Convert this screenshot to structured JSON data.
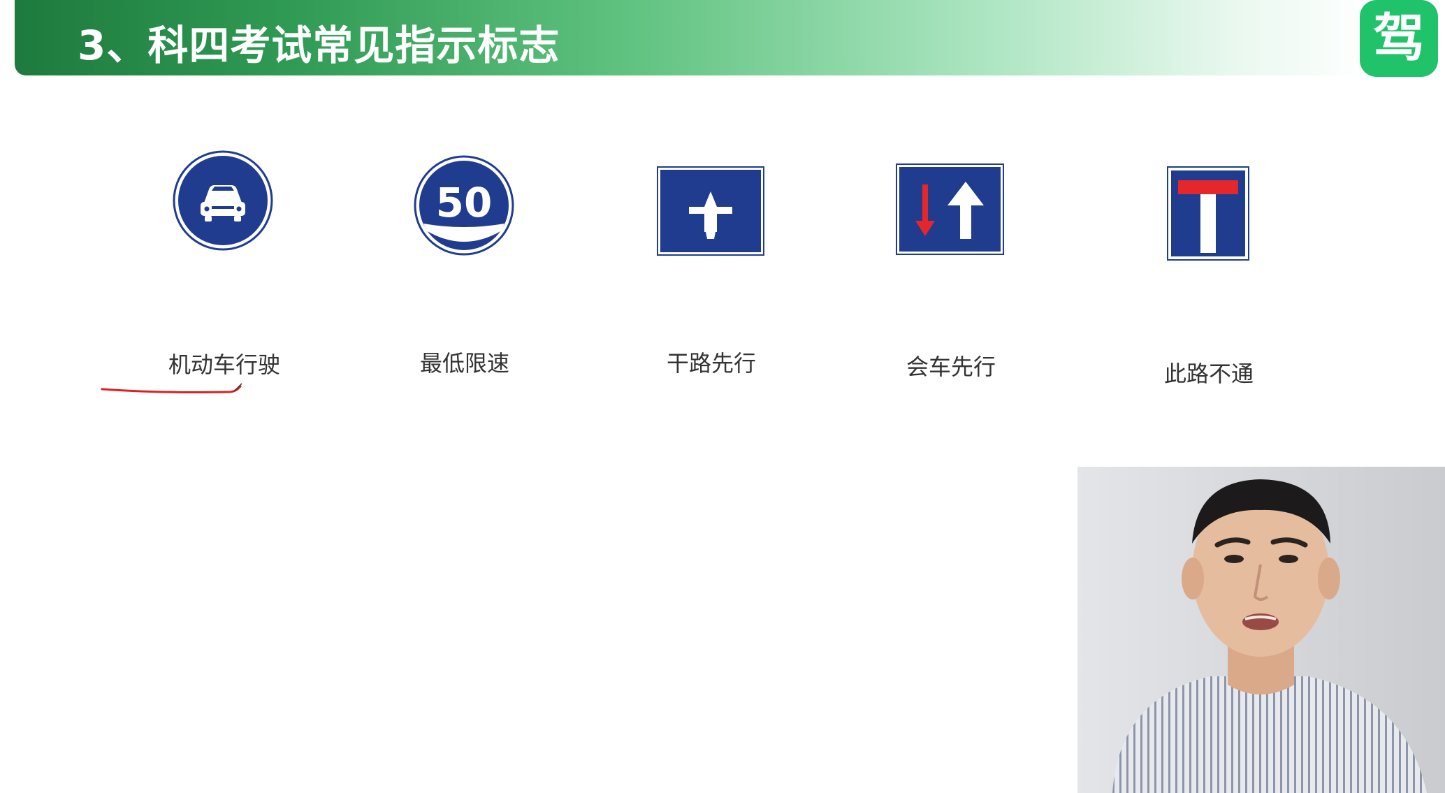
{
  "header": {
    "title": "3、科四考试常见指示标志",
    "brand_logo_char": "驾"
  },
  "signs": [
    {
      "icon": "motor-vehicle-sign-icon",
      "label": "机动车行驶"
    },
    {
      "icon": "minimum-speed-sign-icon",
      "label": "最低限速",
      "value": "50"
    },
    {
      "icon": "main-road-priority-sign-icon",
      "label": "干路先行"
    },
    {
      "icon": "meeting-priority-sign-icon",
      "label": "会车先行"
    },
    {
      "icon": "no-through-road-sign-icon",
      "label": "此路不通"
    }
  ],
  "annotation": {
    "type": "red-underline",
    "target": "机动车行驶",
    "color": "#e02020"
  },
  "video_overlay": {
    "subject": "presenter webcam"
  },
  "colors": {
    "sign_blue": "#1f3c8f",
    "sign_red": "#e5262a",
    "header_green_dark": "#1e7a3e",
    "brand_green": "#20c26a"
  }
}
